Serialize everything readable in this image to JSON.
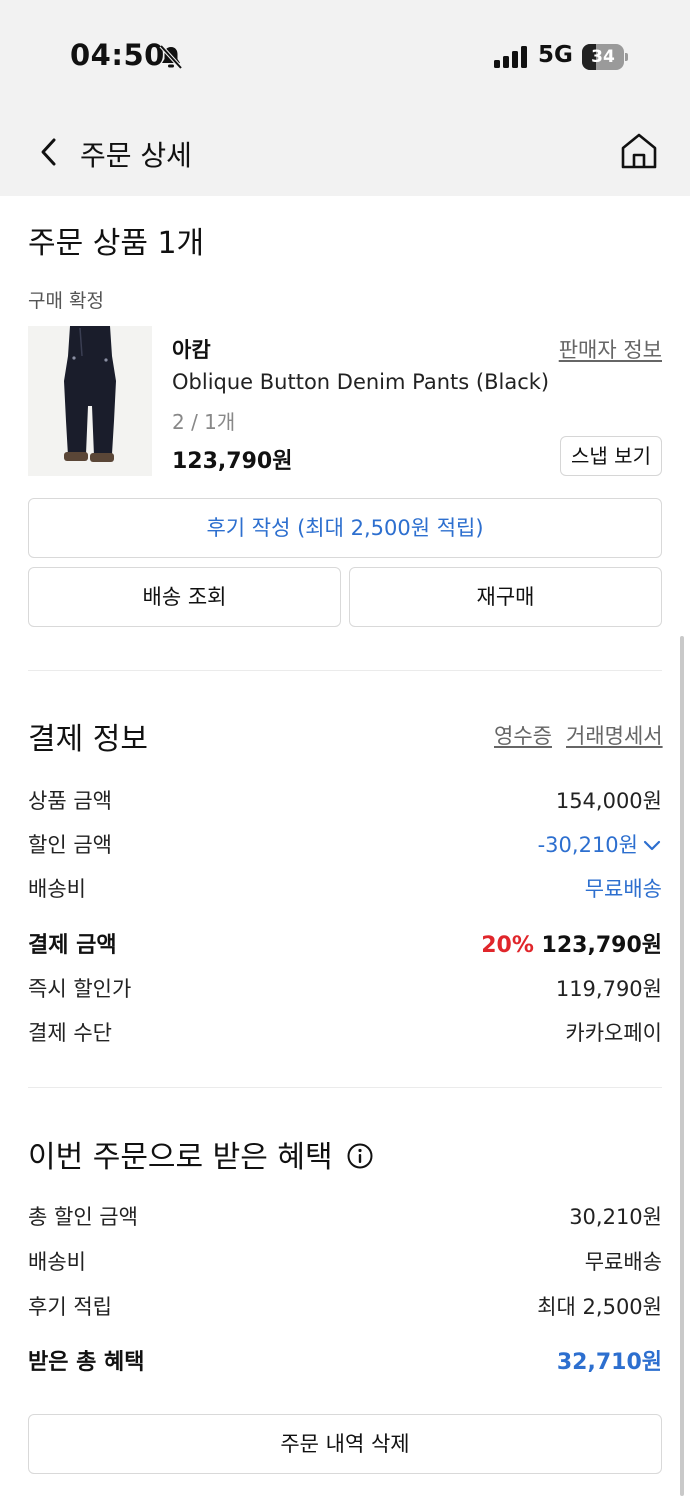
{
  "status_bar": {
    "time": "04:50",
    "network": "5G",
    "battery": "34",
    "battery_level": 0.34
  },
  "header": {
    "title": "주문 상세"
  },
  "order_items": {
    "title": "주문 상품 1개",
    "status": "구매 확정",
    "product": {
      "brand": "아캄",
      "seller_info_label": "판매자 정보",
      "name": "Oblique Button Denim Pants (Black)",
      "option": "2 / 1개",
      "price": "123,790원",
      "snap_label": "스냅 보기"
    },
    "review_button": "후기 작성 (최대 2,500원 적립)",
    "delivery_button": "배송 조회",
    "reorder_button": "재구매"
  },
  "payment": {
    "title": "결제 정보",
    "receipt_link": "영수증",
    "statement_link": "거래명세서",
    "rows": [
      {
        "label": "상품 금액",
        "value": "154,000원"
      },
      {
        "label": "할인 금액",
        "value": "-30,210원"
      },
      {
        "label": "배송비",
        "value": "무료배송"
      },
      {
        "label": "결제 금액",
        "rate": "20%",
        "value": "123,790원"
      },
      {
        "label": "즉시 할인가",
        "value": "119,790원"
      },
      {
        "label": "결제 수단",
        "value": "카카오페이"
      }
    ]
  },
  "benefits": {
    "title": "이번 주문으로 받은 혜택",
    "rows": [
      {
        "label": "총 할인 금액",
        "value": "30,210원"
      },
      {
        "label": "배송비",
        "value": "무료배송"
      },
      {
        "label": "후기 적립",
        "value": "최대 2,500원"
      },
      {
        "label": "받은 총 혜택",
        "value": "32,710원"
      }
    ]
  },
  "delete_button": "주문 내역 삭제",
  "colors": {
    "accent_blue": "#2d6fcf",
    "discount_red": "#e0262b",
    "header_bg": "#f2f2f2"
  }
}
